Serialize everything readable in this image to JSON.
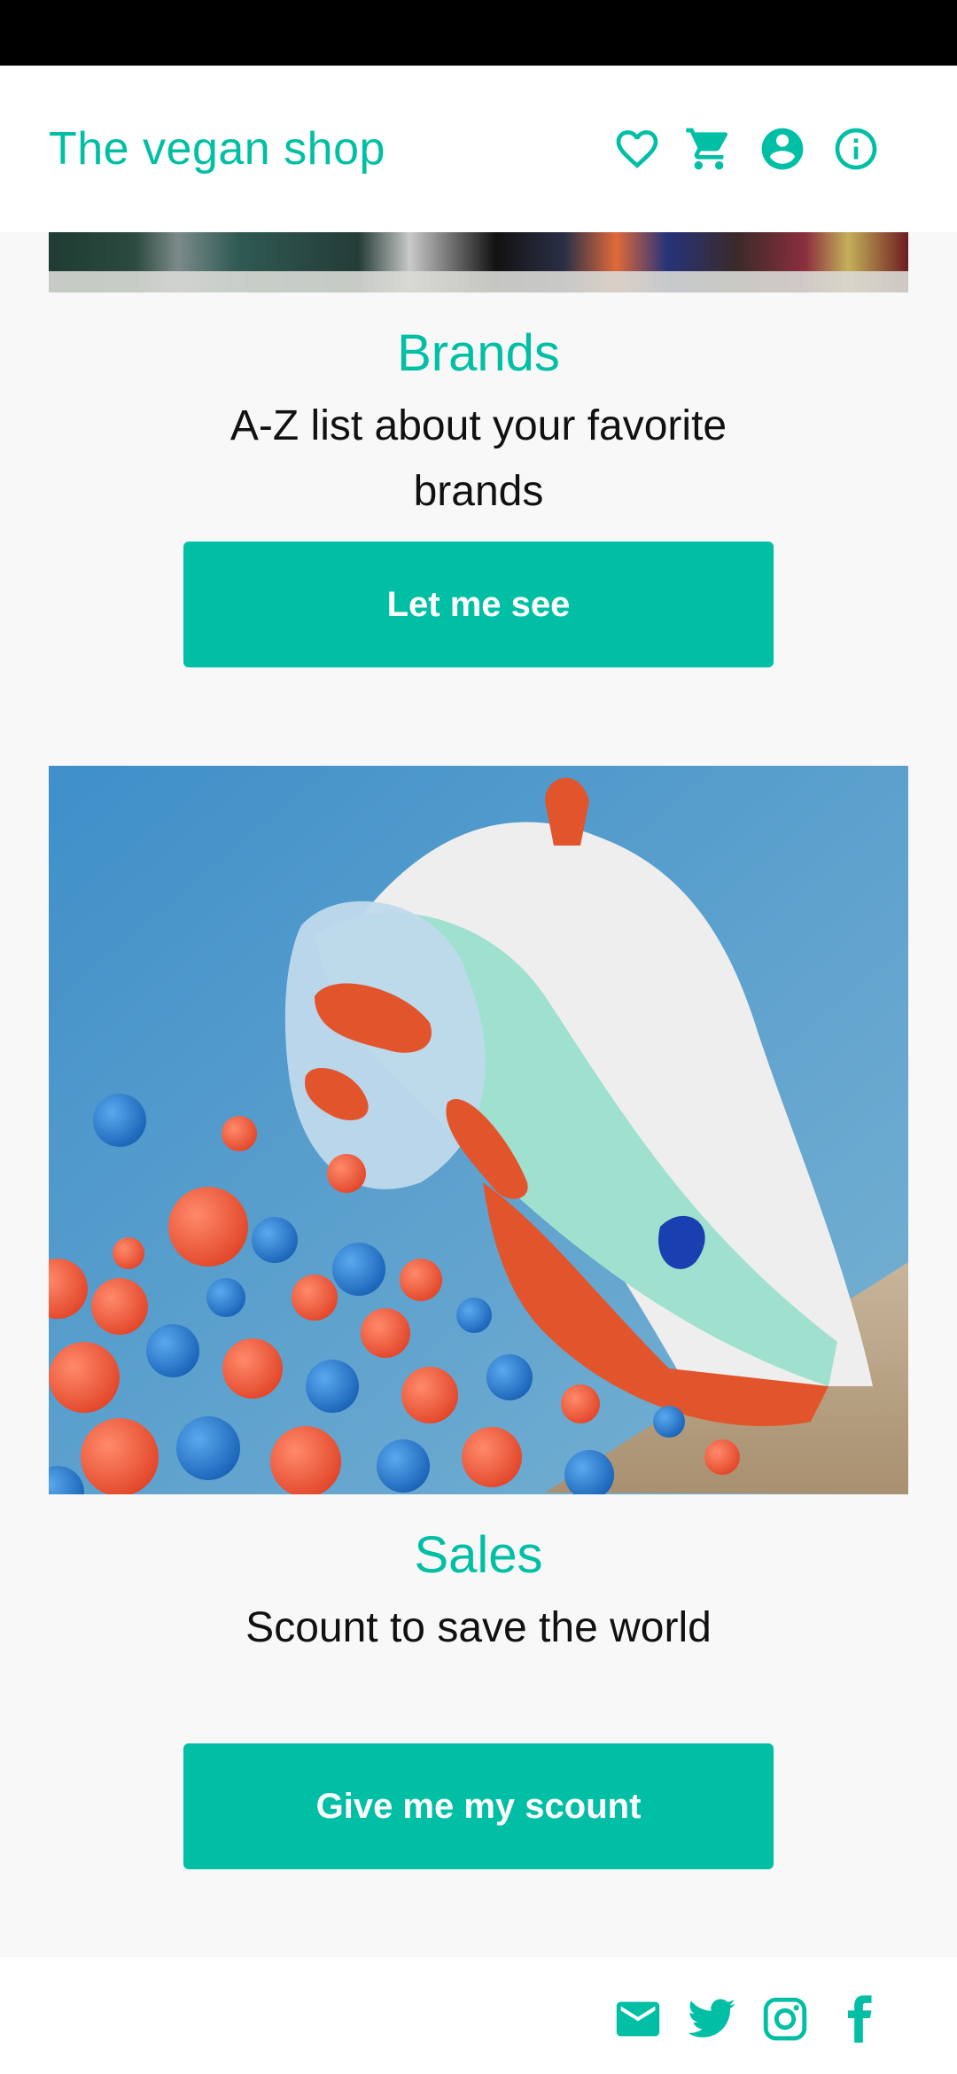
{
  "theme": {
    "accent": "#00bfa5",
    "background": "#f8f8f8"
  },
  "header": {
    "title": "The vegan shop",
    "icons": [
      "heart-icon",
      "cart-icon",
      "account-icon",
      "info-icon"
    ]
  },
  "sections": [
    {
      "title": "Brands",
      "text": "A-Z list about your favorite brands",
      "button": "Let me see"
    },
    {
      "title": "Sales",
      "text": "Scount to save the world",
      "button": "Give me my scount"
    }
  ],
  "footer": {
    "icons": [
      "mail-icon",
      "twitter-icon",
      "instagram-icon",
      "facebook-icon"
    ]
  }
}
